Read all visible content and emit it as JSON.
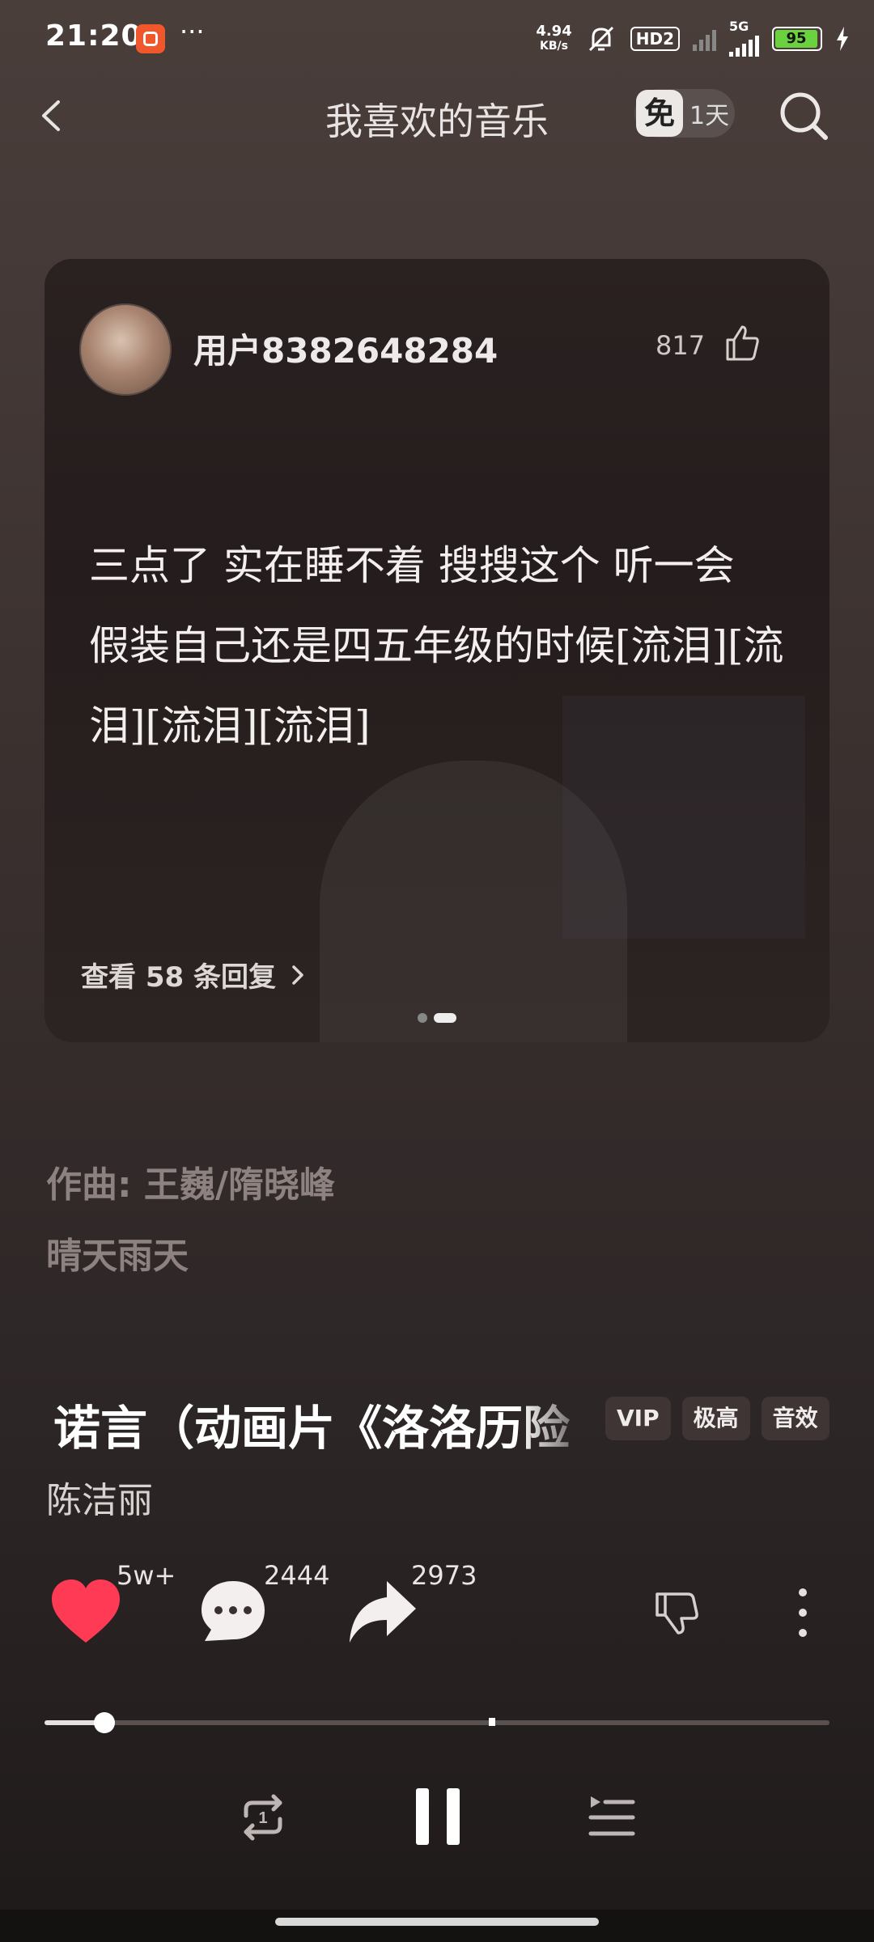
{
  "status_bar": {
    "time": "21:20",
    "net_speed_value": "4.94",
    "net_speed_unit": "KB/s",
    "hd_label": "HD2",
    "signal_label": "5G",
    "battery": "95"
  },
  "header": {
    "title": "我喜欢的音乐",
    "free_icon_text": "免",
    "free_days": "1天"
  },
  "comment_card": {
    "username": "用户8382648284",
    "like_count": "817",
    "comment_text": "三点了 实在睡不着 搜搜这个 听一会 假装自己还是四五年级的时候[流泪][流泪][流泪][流泪]",
    "replies_label": "查看 58 条回复",
    "page_index": 2,
    "page_count": 2
  },
  "credits": {
    "composer": "作曲: 王巍/隋晓峰",
    "next_line": "晴天雨天"
  },
  "song": {
    "title": "诺言（动画片《洛洛历险",
    "badges": [
      "VIP",
      "极高",
      "音效"
    ],
    "artist": "陈洁丽"
  },
  "actions": {
    "like_count": "5w+",
    "comment_count": "2444",
    "share_count": "2973",
    "liked": true
  },
  "playback": {
    "progress_fraction": 0.076,
    "buffer_marker_fraction": 0.57,
    "state": "playing",
    "repeat_mode": "repeat-one"
  },
  "colors": {
    "like_heart": "#ff3a55",
    "battery_level": "#6bd23f",
    "app_badge": "#f0572a"
  }
}
